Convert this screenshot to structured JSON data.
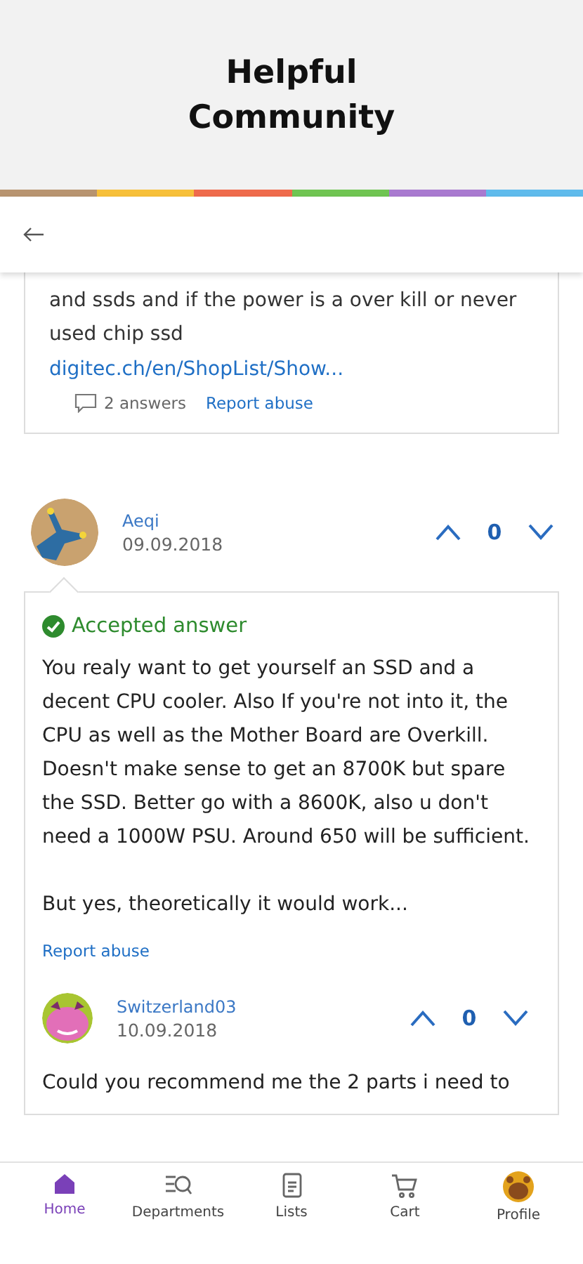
{
  "header": {
    "title": "Helpful Community"
  },
  "question": {
    "body_lines": [
      "and ssds and if the power is a over kill or never",
      "used chip ssd"
    ],
    "link": "digitec.ch/en/ShopList/Show...",
    "answers": "2 answers",
    "report": "Report abuse"
  },
  "answer": {
    "author": "Aeqi",
    "date": "09.09.2018",
    "votes": "0",
    "accepted": true,
    "accepted_label": "Accepted answer",
    "paragraphs": [
      "You realy want to get yourself an SSD and a decent CPU cooler. Also If you're not into it, the CPU as well as the Mother Board are Overkill. Doesn't make sense to get an 8700K but spare the SSD. Better go with a 8600K, also u don't need a 1000W PSU. Around 650 will be sufficient.",
      "But yes, theoretically it would work..."
    ],
    "report": "Report abuse",
    "reply": {
      "author": "Switzerland03",
      "date": "10.09.2018",
      "votes": "0",
      "body": "Could you recommend me the 2 parts i need to"
    }
  },
  "nav": [
    {
      "label": "Home",
      "kind": "home",
      "selected": true
    },
    {
      "label": "Departments",
      "kind": "departments",
      "selected": false
    },
    {
      "label": "Lists",
      "kind": "lists",
      "selected": false
    },
    {
      "label": "Cart",
      "kind": "cart",
      "selected": false
    },
    {
      "label": "Profile",
      "kind": "profile",
      "selected": false
    }
  ]
}
